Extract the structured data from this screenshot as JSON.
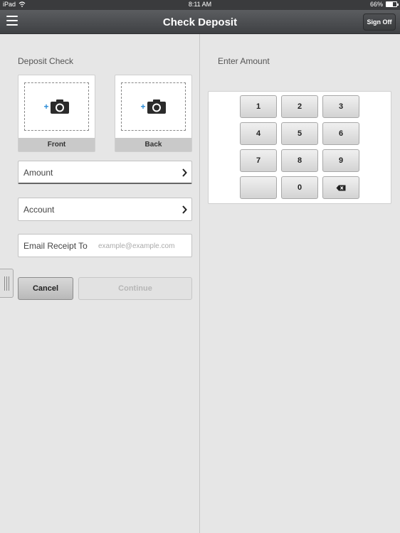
{
  "status_bar": {
    "device": "iPad",
    "time": "8:11 AM",
    "battery_text": "66%",
    "battery_level": 0.66
  },
  "nav": {
    "title": "Check Deposit",
    "sign_off_label": "Sign Off",
    "menu_icon": "hamburger-icon"
  },
  "left": {
    "title": "Deposit Check",
    "photo_front_label": "Front",
    "photo_back_label": "Back",
    "camera_icon": "add-camera-icon",
    "amount_label": "Amount",
    "account_label": "Account",
    "email_label": "Email Receipt To",
    "email_placeholder": "example@example.com",
    "email_value": "",
    "cancel_label": "Cancel",
    "continue_label": "Continue"
  },
  "right": {
    "title": "Enter Amount",
    "keys": [
      "1",
      "2",
      "3",
      "4",
      "5",
      "6",
      "7",
      "8",
      "9",
      "",
      "0",
      "backspace"
    ]
  },
  "colors": {
    "accent_plus": "#2a8bd6",
    "nav_bg": "#4a4c4f",
    "page_bg": "#e6e6e6"
  }
}
